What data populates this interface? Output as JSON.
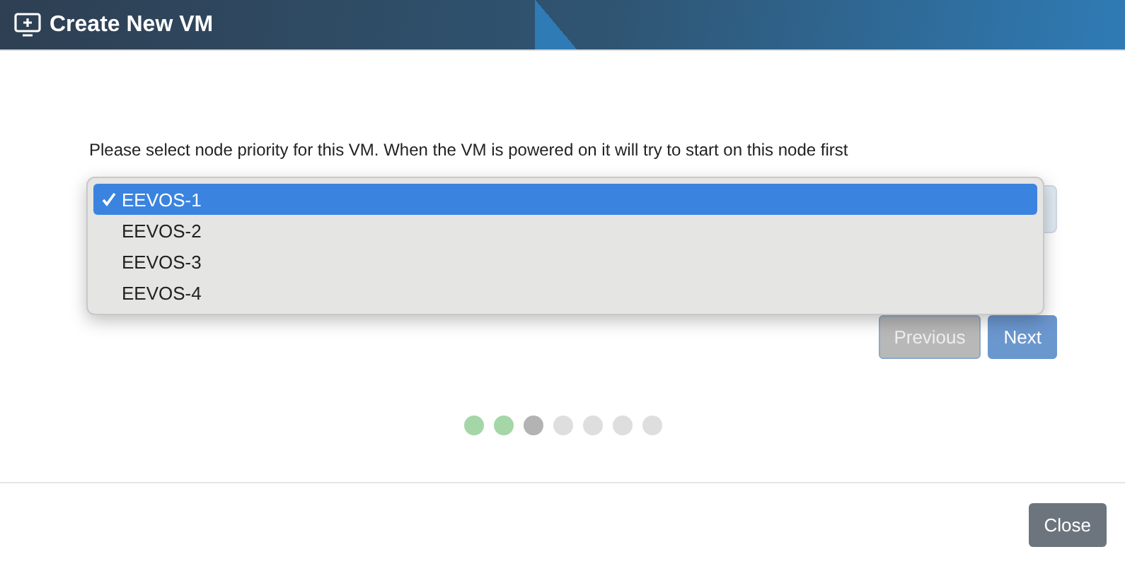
{
  "window": {
    "title": "Create New VM"
  },
  "prompt": "Please select node priority for this VM. When the VM is powered on it will try to start on this node first",
  "node_options": [
    {
      "label": "EEVOS-1",
      "selected": true
    },
    {
      "label": "EEVOS-2",
      "selected": false
    },
    {
      "label": "EEVOS-3",
      "selected": false
    },
    {
      "label": "EEVOS-4",
      "selected": false
    }
  ],
  "nav_buttons": [
    {
      "label": "Previous",
      "disabled": true
    },
    {
      "label": "Next",
      "disabled": false
    }
  ],
  "steps": [
    {
      "done": true,
      "current": false
    },
    {
      "done": true,
      "current": false
    },
    {
      "done": false,
      "current": true
    },
    {
      "done": false,
      "current": false
    },
    {
      "done": false,
      "current": false
    },
    {
      "done": false,
      "current": false
    },
    {
      "done": false,
      "current": false
    }
  ],
  "footer_buttons": [
    "Close"
  ]
}
